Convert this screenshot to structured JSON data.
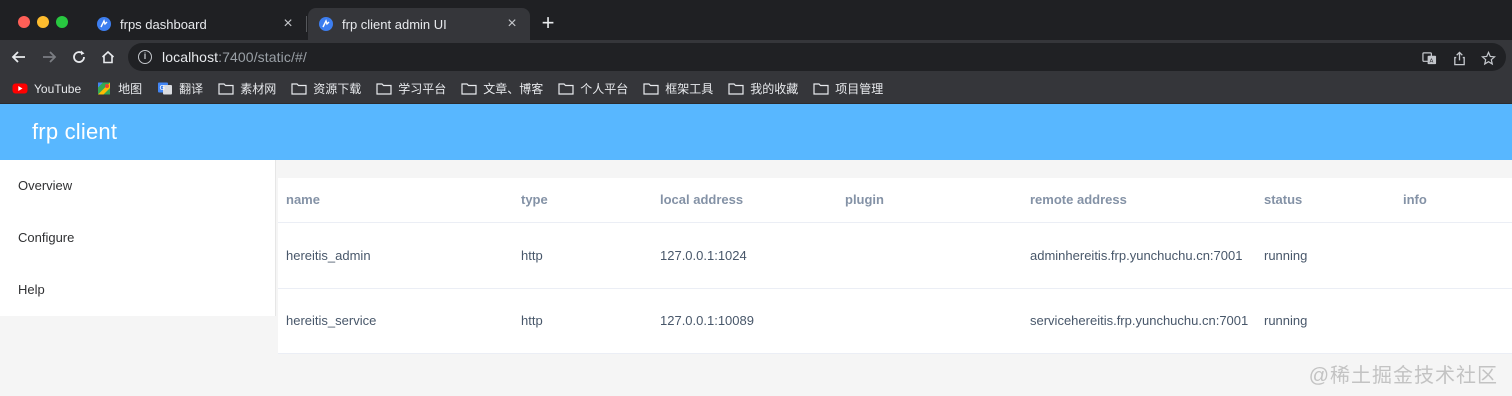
{
  "browser": {
    "tabs": [
      {
        "title": "frps dashboard",
        "active": false
      },
      {
        "title": "frp client admin UI",
        "active": true
      }
    ],
    "new_tab_symbol": "+",
    "close_symbol": "×",
    "url_host": "localhost",
    "url_rest": ":7400/static/#/",
    "bookmarks": [
      {
        "label": "YouTube",
        "icon": "youtube-icon"
      },
      {
        "label": "地图",
        "icon": "maps-icon"
      },
      {
        "label": "翻译",
        "icon": "translate-icon"
      },
      {
        "label": "素材网",
        "icon": "folder-icon"
      },
      {
        "label": "资源下载",
        "icon": "folder-icon"
      },
      {
        "label": "学习平台",
        "icon": "folder-icon"
      },
      {
        "label": "文章、博客",
        "icon": "folder-icon"
      },
      {
        "label": "个人平台",
        "icon": "folder-icon"
      },
      {
        "label": "框架工具",
        "icon": "folder-icon"
      },
      {
        "label": "我的收藏",
        "icon": "folder-icon"
      },
      {
        "label": "项目管理",
        "icon": "folder-icon"
      }
    ]
  },
  "app": {
    "title": "frp client",
    "header_color": "#58b7ff"
  },
  "sidebar": {
    "items": [
      {
        "label": "Overview"
      },
      {
        "label": "Configure"
      },
      {
        "label": "Help"
      }
    ]
  },
  "table": {
    "columns": [
      "name",
      "type",
      "local address",
      "plugin",
      "remote address",
      "status",
      "info"
    ],
    "rows": [
      {
        "name": "hereitis_admin",
        "type": "http",
        "local_address": "127.0.0.1:1024",
        "plugin": "",
        "remote_address": "adminhereitis.frp.yunchuchu.cn:7001",
        "status": "running",
        "info": ""
      },
      {
        "name": "hereitis_service",
        "type": "http",
        "local_address": "127.0.0.1:10089",
        "plugin": "",
        "remote_address": "servicehereitis.frp.yunchuchu.cn:7001",
        "status": "running",
        "info": ""
      }
    ]
  },
  "watermark": "@稀土掘金技术社区"
}
